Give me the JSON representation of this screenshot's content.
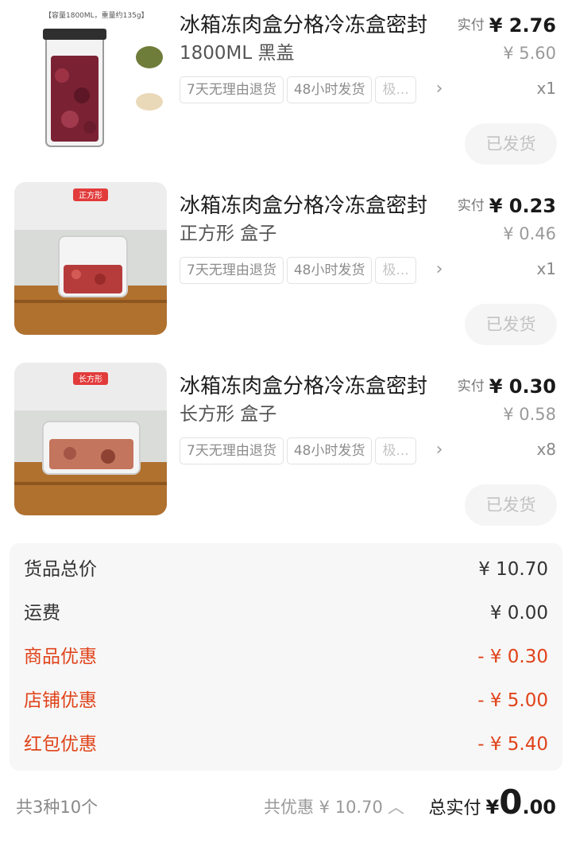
{
  "items": [
    {
      "title": "冰箱冻肉盒分格冷冻盒密封",
      "spec": "1800ML 黑盖",
      "tags": [
        "7天无理由退货",
        "48小时发货",
        "极..."
      ],
      "paid_label": "实付",
      "paid_amount": "¥ 2.76",
      "original_price": "¥ 5.60",
      "quantity": "x1",
      "status_button": "已发货",
      "image_caption": "【容量1800ML，重量约135g】",
      "image_sticker": ""
    },
    {
      "title": "冰箱冻肉盒分格冷冻盒密封",
      "spec": "正方形 盒子",
      "tags": [
        "7天无理由退货",
        "48小时发货",
        "极..."
      ],
      "paid_label": "实付",
      "paid_amount": "¥ 0.23",
      "original_price": "¥ 0.46",
      "quantity": "x1",
      "status_button": "已发货",
      "image_caption": "",
      "image_sticker": "正方形"
    },
    {
      "title": "冰箱冻肉盒分格冷冻盒密封",
      "spec": "长方形 盒子",
      "tags": [
        "7天无理由退货",
        "48小时发货",
        "极..."
      ],
      "paid_label": "实付",
      "paid_amount": "¥ 0.30",
      "original_price": "¥ 0.58",
      "quantity": "x8",
      "status_button": "已发货",
      "image_caption": "",
      "image_sticker": "长方形"
    }
  ],
  "summary": {
    "goods_total": {
      "label": "货品总价",
      "value": "¥ 10.70"
    },
    "shipping": {
      "label": "运费",
      "value": "¥ 0.00"
    },
    "product_discount": {
      "label": "商品优惠",
      "value": "- ¥ 0.30"
    },
    "store_discount": {
      "label": "店铺优惠",
      "value": "- ¥ 5.00"
    },
    "red_packet_discount": {
      "label": "红包优惠",
      "value": "- ¥ 5.40"
    }
  },
  "footer": {
    "item_count": "共3种10个",
    "total_discount": "共优惠 ¥ 10.70",
    "total_paid_label": "总实付",
    "total_paid_currency": "¥",
    "total_paid_integer": "0",
    "total_paid_decimal": ".00"
  },
  "colors": {
    "discount_red": "#e0431a",
    "button_bg": "#f5f5f5",
    "summary_bg": "#f7f7f7"
  }
}
